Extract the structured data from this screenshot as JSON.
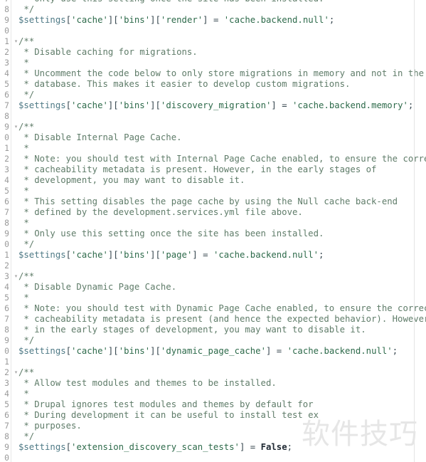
{
  "editor": {
    "name": "php-code-editor",
    "language": "PHP",
    "colors": {
      "background": "#ffffff",
      "comment": "#5f7c69",
      "variable": "#4f7a86",
      "string": "#2d6a4a",
      "punctuation": "#37474f",
      "keyword": "#1f2933",
      "line_number": "#9a9a9a",
      "ruler": "#e4e4e4",
      "gutter_separator": "#e8e8e8",
      "watermark": "#e6e6e6"
    },
    "fold_marker_icon": "chevron-down-icon",
    "fold_marker_glyph": "▾",
    "watermark_text": "软件技巧"
  },
  "lines": [
    {
      "num": "7",
      "fold": "",
      "text": " * Only use this setting once the site has been installed.",
      "tokens": [
        {
          "t": " * Only use this setting once the site has been installed.",
          "c": "c"
        }
      ]
    },
    {
      "num": "8",
      "fold": "",
      "text": " */",
      "tokens": [
        {
          "t": " */",
          "c": "c"
        }
      ]
    },
    {
      "num": "9",
      "fold": "",
      "text": "$settings['cache']['bins']['render'] = 'cache.backend.null';",
      "tokens": [
        {
          "t": "$settings",
          "c": "v"
        },
        {
          "t": "[",
          "c": "p"
        },
        {
          "t": "'cache'",
          "c": "s"
        },
        {
          "t": "]",
          "c": "p"
        },
        {
          "t": "[",
          "c": "p"
        },
        {
          "t": "'bins'",
          "c": "s"
        },
        {
          "t": "]",
          "c": "p"
        },
        {
          "t": "[",
          "c": "p"
        },
        {
          "t": "'render'",
          "c": "s"
        },
        {
          "t": "]",
          "c": "p"
        },
        {
          "t": " = ",
          "c": "p"
        },
        {
          "t": "'cache.backend.null'",
          "c": "s"
        },
        {
          "t": ";",
          "c": "p"
        }
      ]
    },
    {
      "num": "0",
      "fold": "",
      "text": "",
      "tokens": []
    },
    {
      "num": "1",
      "fold": "▾",
      "text": "/**",
      "tokens": [
        {
          "t": "/**",
          "c": "c"
        }
      ]
    },
    {
      "num": "2",
      "fold": "",
      "text": " * Disable caching for migrations.",
      "tokens": [
        {
          "t": " * Disable caching for migrations.",
          "c": "c"
        }
      ]
    },
    {
      "num": "3",
      "fold": "",
      "text": " *",
      "tokens": [
        {
          "t": " *",
          "c": "c"
        }
      ]
    },
    {
      "num": "4",
      "fold": "",
      "text": " * Uncomment the code below to only store migrations in memory and not in the",
      "tokens": [
        {
          "t": " * Uncomment the code below to only store migrations in memory and not in the",
          "c": "c"
        }
      ]
    },
    {
      "num": "5",
      "fold": "",
      "text": " * database. This makes it easier to develop custom migrations.",
      "tokens": [
        {
          "t": " * database. This makes it easier to develop custom migrations.",
          "c": "c"
        }
      ]
    },
    {
      "num": "6",
      "fold": "",
      "text": " */",
      "tokens": [
        {
          "t": " */",
          "c": "c"
        }
      ]
    },
    {
      "num": "7",
      "fold": "",
      "text": "$settings['cache']['bins']['discovery_migration'] = 'cache.backend.memory';",
      "tokens": [
        {
          "t": "$settings",
          "c": "v"
        },
        {
          "t": "[",
          "c": "p"
        },
        {
          "t": "'cache'",
          "c": "s"
        },
        {
          "t": "]",
          "c": "p"
        },
        {
          "t": "[",
          "c": "p"
        },
        {
          "t": "'bins'",
          "c": "s"
        },
        {
          "t": "]",
          "c": "p"
        },
        {
          "t": "[",
          "c": "p"
        },
        {
          "t": "'discovery_migration'",
          "c": "s"
        },
        {
          "t": "]",
          "c": "p"
        },
        {
          "t": " = ",
          "c": "p"
        },
        {
          "t": "'cache.backend.memory'",
          "c": "s"
        },
        {
          "t": ";",
          "c": "p"
        }
      ]
    },
    {
      "num": "8",
      "fold": "",
      "text": "",
      "tokens": []
    },
    {
      "num": "9",
      "fold": "▾",
      "text": "/**",
      "tokens": [
        {
          "t": "/**",
          "c": "c"
        }
      ]
    },
    {
      "num": "0",
      "fold": "",
      "text": " * Disable Internal Page Cache.",
      "tokens": [
        {
          "t": " * Disable Internal Page Cache.",
          "c": "c"
        }
      ]
    },
    {
      "num": "1",
      "fold": "",
      "text": " *",
      "tokens": [
        {
          "t": " *",
          "c": "c"
        }
      ]
    },
    {
      "num": "2",
      "fold": "",
      "text": " * Note: you should test with Internal Page Cache enabled, to ensure the correct",
      "tokens": [
        {
          "t": " * Note: you should test with Internal Page Cache enabled, to ensure the correct",
          "c": "c"
        }
      ]
    },
    {
      "num": "3",
      "fold": "",
      "text": " * cacheability metadata is present. However, in the early stages of",
      "tokens": [
        {
          "t": " * cacheability metadata is present. However, in the early stages of",
          "c": "c"
        }
      ]
    },
    {
      "num": "4",
      "fold": "",
      "text": " * development, you may want to disable it.",
      "tokens": [
        {
          "t": " * development, you may want to disable it.",
          "c": "c"
        }
      ]
    },
    {
      "num": "5",
      "fold": "",
      "text": " *",
      "tokens": [
        {
          "t": " *",
          "c": "c"
        }
      ]
    },
    {
      "num": "6",
      "fold": "",
      "text": " * This setting disables the page cache by using the Null cache back-end",
      "tokens": [
        {
          "t": " * This setting disables the page cache by using the Null cache back-end",
          "c": "c"
        }
      ]
    },
    {
      "num": "7",
      "fold": "",
      "text": " * defined by the development.services.yml file above.",
      "tokens": [
        {
          "t": " * defined by the development.services.yml file above.",
          "c": "c"
        }
      ]
    },
    {
      "num": "8",
      "fold": "",
      "text": " *",
      "tokens": [
        {
          "t": " *",
          "c": "c"
        }
      ]
    },
    {
      "num": "9",
      "fold": "",
      "text": " * Only use this setting once the site has been installed.",
      "tokens": [
        {
          "t": " * Only use this setting once the site has been installed.",
          "c": "c"
        }
      ]
    },
    {
      "num": "0",
      "fold": "",
      "text": " */",
      "tokens": [
        {
          "t": " */",
          "c": "c"
        }
      ]
    },
    {
      "num": "1",
      "fold": "",
      "text": "$settings['cache']['bins']['page'] = 'cache.backend.null';",
      "tokens": [
        {
          "t": "$settings",
          "c": "v"
        },
        {
          "t": "[",
          "c": "p"
        },
        {
          "t": "'cache'",
          "c": "s"
        },
        {
          "t": "]",
          "c": "p"
        },
        {
          "t": "[",
          "c": "p"
        },
        {
          "t": "'bins'",
          "c": "s"
        },
        {
          "t": "]",
          "c": "p"
        },
        {
          "t": "[",
          "c": "p"
        },
        {
          "t": "'page'",
          "c": "s"
        },
        {
          "t": "]",
          "c": "p"
        },
        {
          "t": " = ",
          "c": "p"
        },
        {
          "t": "'cache.backend.null'",
          "c": "s"
        },
        {
          "t": ";",
          "c": "p"
        }
      ]
    },
    {
      "num": "2",
      "fold": "",
      "text": "",
      "tokens": []
    },
    {
      "num": "3",
      "fold": "▾",
      "text": "/**",
      "tokens": [
        {
          "t": "/**",
          "c": "c"
        }
      ]
    },
    {
      "num": "4",
      "fold": "",
      "text": " * Disable Dynamic Page Cache.",
      "tokens": [
        {
          "t": " * Disable Dynamic Page Cache.",
          "c": "c"
        }
      ]
    },
    {
      "num": "5",
      "fold": "",
      "text": " *",
      "tokens": [
        {
          "t": " *",
          "c": "c"
        }
      ]
    },
    {
      "num": "6",
      "fold": "",
      "text": " * Note: you should test with Dynamic Page Cache enabled, to ensure the correct",
      "tokens": [
        {
          "t": " * Note: you should test with Dynamic Page Cache enabled, to ensure the correct",
          "c": "c"
        }
      ]
    },
    {
      "num": "7",
      "fold": "",
      "text": " * cacheability metadata is present (and hence the expected behavior). However,",
      "tokens": [
        {
          "t": " * cacheability metadata is present (and hence the expected behavior). However,",
          "c": "c"
        }
      ]
    },
    {
      "num": "8",
      "fold": "",
      "text": " * in the early stages of development, you may want to disable it.",
      "tokens": [
        {
          "t": " * in the early stages of development, you may want to disable it.",
          "c": "c"
        }
      ]
    },
    {
      "num": "9",
      "fold": "",
      "text": " */",
      "tokens": [
        {
          "t": " */",
          "c": "c"
        }
      ]
    },
    {
      "num": "0",
      "fold": "",
      "text": "$settings['cache']['bins']['dynamic_page_cache'] = 'cache.backend.null';",
      "tokens": [
        {
          "t": "$settings",
          "c": "v"
        },
        {
          "t": "[",
          "c": "p"
        },
        {
          "t": "'cache'",
          "c": "s"
        },
        {
          "t": "]",
          "c": "p"
        },
        {
          "t": "[",
          "c": "p"
        },
        {
          "t": "'bins'",
          "c": "s"
        },
        {
          "t": "]",
          "c": "p"
        },
        {
          "t": "[",
          "c": "p"
        },
        {
          "t": "'dynamic_page_cache'",
          "c": "s"
        },
        {
          "t": "]",
          "c": "p"
        },
        {
          "t": " = ",
          "c": "p"
        },
        {
          "t": "'cache.backend.null'",
          "c": "s"
        },
        {
          "t": ";",
          "c": "p"
        }
      ]
    },
    {
      "num": "1",
      "fold": "",
      "text": "",
      "tokens": []
    },
    {
      "num": "2",
      "fold": "▾",
      "text": "/**",
      "tokens": [
        {
          "t": "/**",
          "c": "c"
        }
      ]
    },
    {
      "num": "3",
      "fold": "",
      "text": " * Allow test modules and themes to be installed.",
      "tokens": [
        {
          "t": " * Allow test modules and themes to be installed.",
          "c": "c"
        }
      ]
    },
    {
      "num": "4",
      "fold": "",
      "text": " *",
      "tokens": [
        {
          "t": " *",
          "c": "c"
        }
      ]
    },
    {
      "num": "5",
      "fold": "",
      "text": " * Drupal ignores test modules and themes by default for",
      "tokens": [
        {
          "t": " * Drupal ignores test modules and themes by default for",
          "c": "c"
        }
      ]
    },
    {
      "num": "6",
      "fold": "",
      "text": " * During development it can be useful to install test ex",
      "tokens": [
        {
          "t": " * During development it can be useful to install test ex",
          "c": "c"
        }
      ]
    },
    {
      "num": "7",
      "fold": "",
      "text": " * purposes.",
      "tokens": [
        {
          "t": " * purposes.",
          "c": "c"
        }
      ]
    },
    {
      "num": "8",
      "fold": "",
      "text": " */",
      "tokens": [
        {
          "t": " */",
          "c": "c"
        }
      ]
    },
    {
      "num": "9",
      "fold": "",
      "text": "$settings['extension_discovery_scan_tests'] = False;",
      "tokens": [
        {
          "t": "$settings",
          "c": "v"
        },
        {
          "t": "[",
          "c": "p"
        },
        {
          "t": "'extension_discovery_scan_tests'",
          "c": "s"
        },
        {
          "t": "]",
          "c": "p"
        },
        {
          "t": " = ",
          "c": "p"
        },
        {
          "t": "False",
          "c": "k"
        },
        {
          "t": ";",
          "c": "p"
        }
      ]
    },
    {
      "num": "0",
      "fold": "",
      "text": "",
      "tokens": []
    }
  ]
}
